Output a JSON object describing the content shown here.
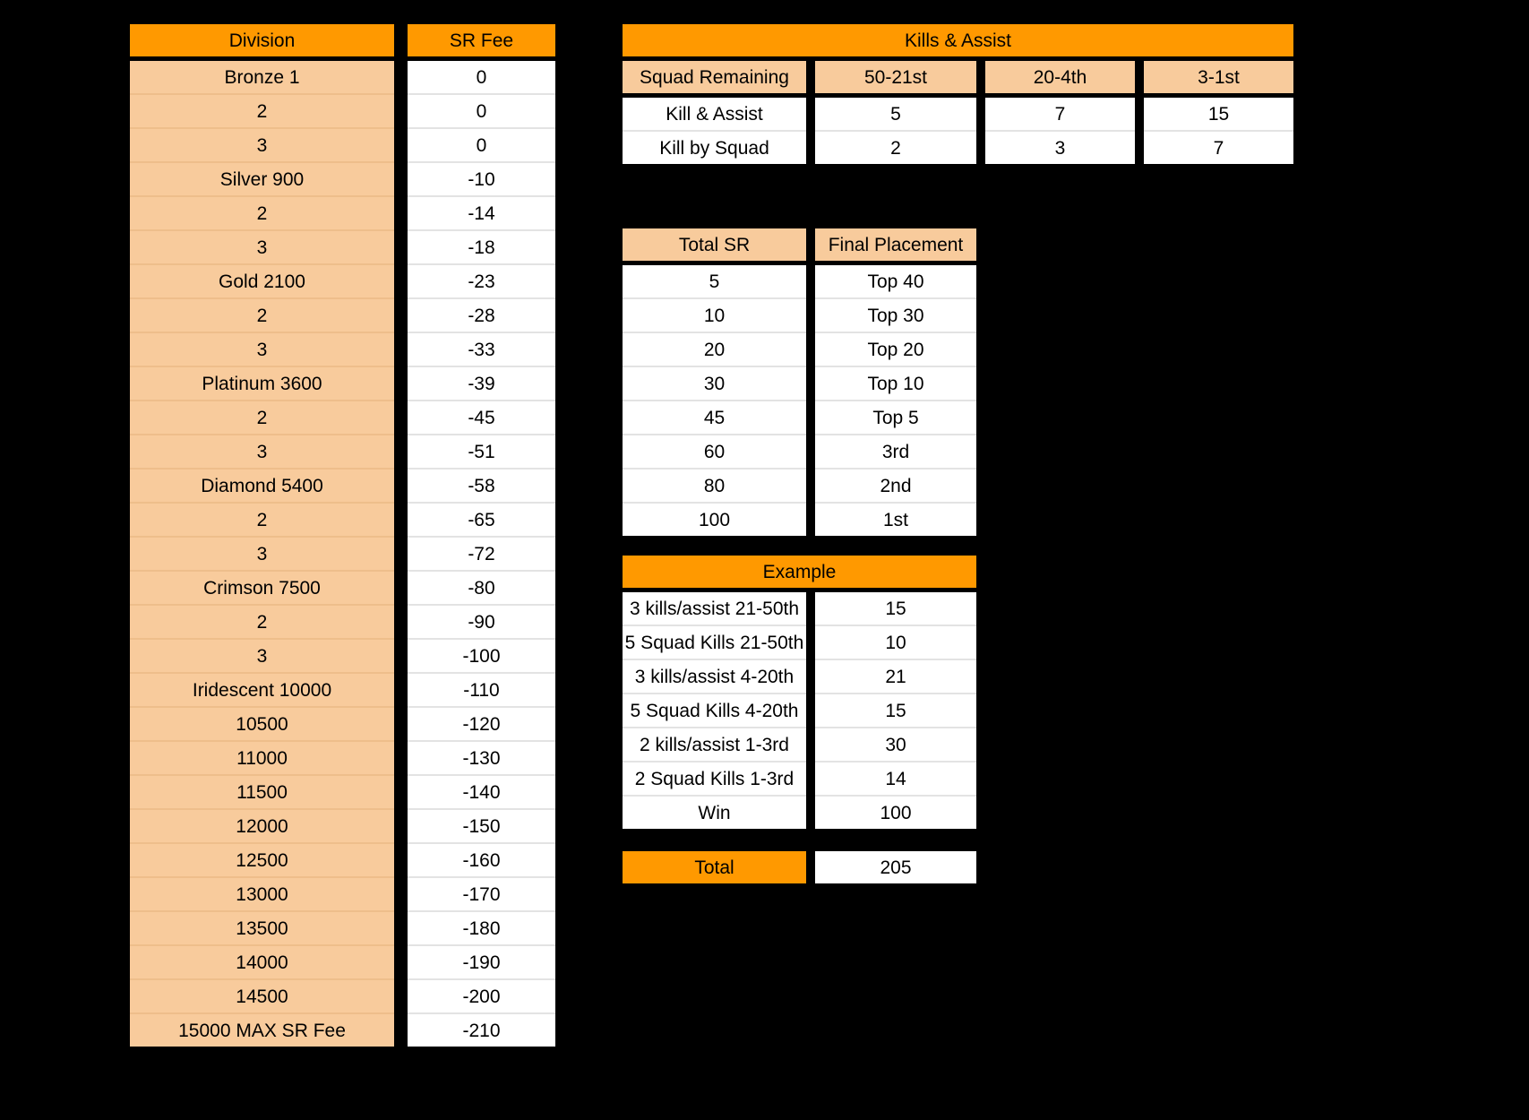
{
  "colors": {
    "header_orange": "#FF9900",
    "header_peach": "#F8CB9C",
    "cell_white": "#FFFFFF",
    "background": "#000000",
    "row_separator": "#E3E3E3"
  },
  "division_table": {
    "headers": [
      "Division",
      "SR Fee"
    ],
    "rows": [
      [
        "Bronze 1",
        "0"
      ],
      [
        "2",
        "0"
      ],
      [
        "3",
        "0"
      ],
      [
        "Silver 900",
        "-10"
      ],
      [
        "2",
        "-14"
      ],
      [
        "3",
        "-18"
      ],
      [
        "Gold 2100",
        "-23"
      ],
      [
        "2",
        "-28"
      ],
      [
        "3",
        "-33"
      ],
      [
        "Platinum 3600",
        "-39"
      ],
      [
        "2",
        "-45"
      ],
      [
        "3",
        "-51"
      ],
      [
        "Diamond 5400",
        "-58"
      ],
      [
        "2",
        "-65"
      ],
      [
        "3",
        "-72"
      ],
      [
        "Crimson 7500",
        "-80"
      ],
      [
        "2",
        "-90"
      ],
      [
        "3",
        "-100"
      ],
      [
        "Iridescent 10000",
        "-110"
      ],
      [
        "10500",
        "-120"
      ],
      [
        "11000",
        "-130"
      ],
      [
        "11500",
        "-140"
      ],
      [
        "12000",
        "-150"
      ],
      [
        "12500",
        "-160"
      ],
      [
        "13000",
        "-170"
      ],
      [
        "13500",
        "-180"
      ],
      [
        "14000",
        "-190"
      ],
      [
        "14500",
        "-200"
      ],
      [
        "15000 MAX SR Fee",
        "-210"
      ]
    ]
  },
  "kills_assist_table": {
    "title": "Kills & Assist",
    "headers": [
      "Squad Remaining",
      "50-21st",
      "20-4th",
      "3-1st"
    ],
    "rows": [
      [
        "Kill & Assist",
        "5",
        "7",
        "15"
      ],
      [
        "Kill by Squad",
        "2",
        "3",
        "7"
      ]
    ]
  },
  "total_sr_table": {
    "headers": [
      "Total SR",
      "Final Placement"
    ],
    "rows": [
      [
        "5",
        "Top 40"
      ],
      [
        "10",
        "Top 30"
      ],
      [
        "20",
        "Top 20"
      ],
      [
        "30",
        "Top 10"
      ],
      [
        "45",
        "Top 5"
      ],
      [
        "60",
        "3rd"
      ],
      [
        "80",
        "2nd"
      ],
      [
        "100",
        "1st"
      ]
    ]
  },
  "example_table": {
    "title": "Example",
    "rows": [
      [
        "3 kills/assist 21-50th",
        "15"
      ],
      [
        "5 Squad Kills 21-50th",
        "10"
      ],
      [
        "3 kills/assist 4-20th",
        "21"
      ],
      [
        "5 Squad Kills 4-20th",
        "15"
      ],
      [
        "2 kills/assist 1-3rd",
        "30"
      ],
      [
        "2 Squad Kills 1-3rd",
        "14"
      ],
      [
        "Win",
        "100"
      ]
    ]
  },
  "total_table": {
    "label": "Total",
    "value": "205"
  }
}
